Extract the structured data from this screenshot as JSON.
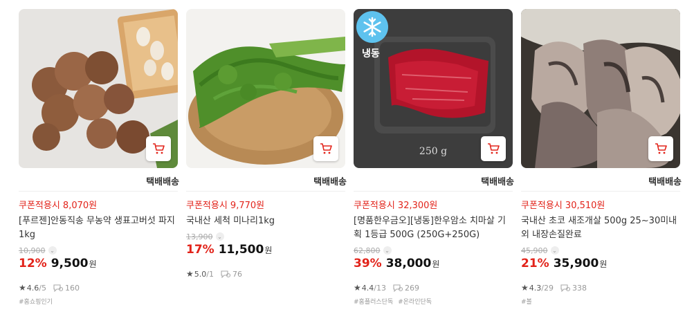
{
  "accent": "#e2231a",
  "products": [
    {
      "shipping": "택배배송",
      "coupon": "쿠폰적용시 8,070원",
      "name": "[푸르젠]안동직송 무농약 생표고버섯 파지 1kg",
      "original_price": "10,900",
      "discount": "12%",
      "price": "9,500",
      "currency": "원",
      "rating": "4.6",
      "rating_count": "/5",
      "reviews": "160",
      "tags": [
        "#홈쇼핑인기"
      ]
    },
    {
      "shipping": "택배배송",
      "coupon": "쿠폰적용시 9,770원",
      "name": "국내산 세척 미나리1kg",
      "original_price": "13,900",
      "discount": "17%",
      "price": "11,500",
      "currency": "원",
      "rating": "5.0",
      "rating_count": "/1",
      "reviews": "76",
      "tags": []
    },
    {
      "shipping": "택배배송",
      "badge": "냉동",
      "image_label": "250 g",
      "coupon": "쿠폰적용시 32,300원",
      "name": "[명품한우금오][냉동]한우암소 치마살 기획 1등급 500G (250G+250G)",
      "original_price": "62,800",
      "discount": "39%",
      "price": "38,000",
      "currency": "원",
      "rating": "4.4",
      "rating_count": "/13",
      "reviews": "269",
      "tags": [
        "#홈플러스단독",
        "#온라인단독"
      ]
    },
    {
      "shipping": "택배배송",
      "coupon": "쿠폰적용시 30,510원",
      "name": "국내산 초코 새조개살 500g 25~30미내외 내장손질완료",
      "original_price": "45,900",
      "discount": "21%",
      "price": "35,900",
      "currency": "원",
      "rating": "4.3",
      "rating_count": "/29",
      "reviews": "338",
      "tags": [
        "#볼"
      ]
    }
  ]
}
